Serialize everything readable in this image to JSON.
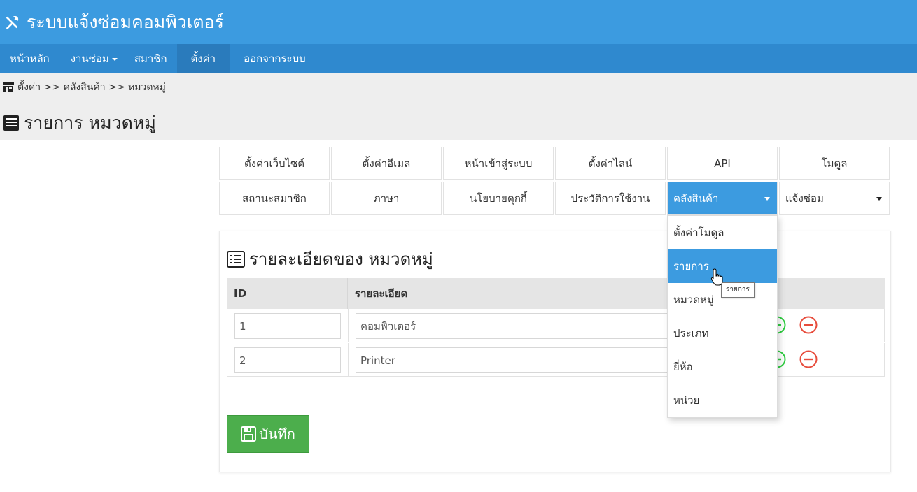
{
  "app": {
    "title": "ระบบแจ้งซ่อมคอมพิวเตอร์",
    "icon": "tools-icon"
  },
  "nav": {
    "items": [
      {
        "label": "หน้าหลัก"
      },
      {
        "label": "งานซ่อม",
        "has_caret": true
      },
      {
        "label": "สมาชิก"
      },
      {
        "label": "ตั้งค่า",
        "active": true
      },
      {
        "label": "ออกจากระบบ"
      }
    ]
  },
  "breadcrumb": {
    "text": "ตั้งค่า >> คลังสินค้า >> หมวดหมู่",
    "icon": "store-icon"
  },
  "page": {
    "title": "รายการ หมวดหมู่",
    "icon": "list-icon"
  },
  "tabs": {
    "row1": [
      "ตั้งค่าเว็บไซต์",
      "ตั้งค่าอีเมล",
      "หน้าเข้าสู่ระบบ",
      "ตั้งค่าไลน์",
      "API",
      "โมดูล"
    ],
    "row2": [
      "สถานะสมาชิก",
      "ภาษา",
      "นโยบายคุกกี้",
      "ประวัติการใช้งาน",
      "คลังสินค้า",
      "แจ้งซ่อม"
    ],
    "active": "คลังสินค้า"
  },
  "panel": {
    "title": "รายละเอียดของ หมวดหมู่",
    "icon": "detail-list-icon",
    "columns": [
      "ID",
      "รายละเอียด"
    ],
    "rows": [
      {
        "id": "1",
        "detail": "คอมพิวเตอร์"
      },
      {
        "id": "2",
        "detail": "Printer"
      }
    ],
    "save_label": "บันทึก"
  },
  "dropdown": {
    "items": [
      "ตั้งค่าโมดูล",
      "รายการ",
      "หมวดหมู่",
      "ประเภท",
      "ยี่ห้อ",
      "หน่วย"
    ],
    "active": "รายการ",
    "tooltip": "รายการ"
  },
  "colors": {
    "header": "#3c9be0",
    "navbar": "#2f89cf",
    "nav_active": "#2a7bbc",
    "save": "#4cae4c",
    "add": "#2ecc40",
    "remove": "#e74c3c"
  }
}
